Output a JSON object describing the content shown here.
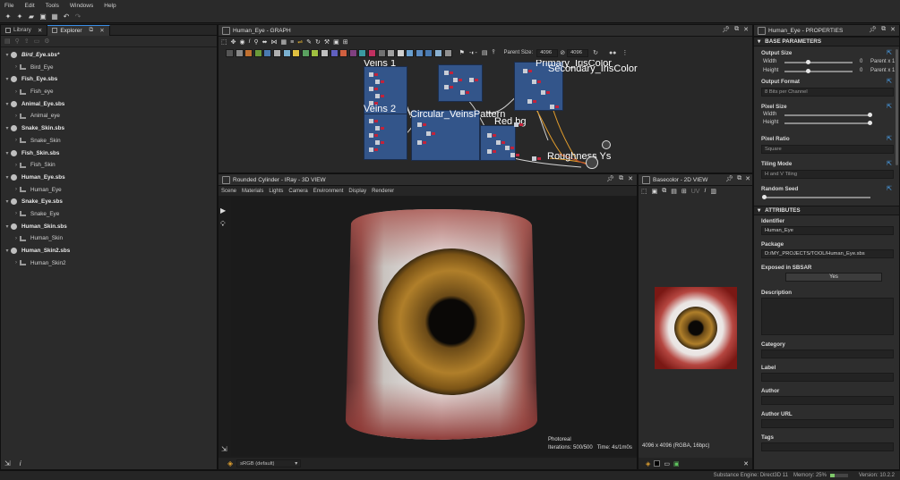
{
  "menu": [
    "File",
    "Edit",
    "Tools",
    "Windows",
    "Help"
  ],
  "left_panel": {
    "tabs": [
      "Library",
      "Explorer"
    ],
    "tree": [
      {
        "name": "Bird_Eye.sbs*",
        "child": "Bird_Eye",
        "italic": true
      },
      {
        "name": "Fish_Eye.sbs",
        "child": "Fish_eye"
      },
      {
        "name": "Animal_Eye.sbs",
        "child": "Animal_eye"
      },
      {
        "name": "Snake_Skin.sbs",
        "child": "Snake_Skin"
      },
      {
        "name": "Fish_Skin.sbs",
        "child": "Fish_Skin"
      },
      {
        "name": "Human_Eye.sbs",
        "child": "Human_Eye"
      },
      {
        "name": "Snake_Eye.sbs",
        "child": "Snake_Eye"
      },
      {
        "name": "Human_Skin.sbs",
        "child": "Human_Skin"
      },
      {
        "name": "Human_Skin2.sbs",
        "child": "Human_Skin2"
      }
    ]
  },
  "graph": {
    "title": "Human_Eye - GRAPH",
    "parent_size_label": "Parent Size:",
    "size_a": "4096",
    "size_b": "4096",
    "frames": {
      "veins1": "Veins 1",
      "veins2": "Veins 2",
      "circular": "Circular_VeinsPattern",
      "redbg": "Red bg",
      "primary": "Primary_IrisColor",
      "secondary": "Secondary_IrisColor",
      "roughness": "Roughness Ys"
    }
  },
  "view3d": {
    "title": "Rounded Cylinder - IRay - 3D VIEW",
    "menu": [
      "Scene",
      "Materials",
      "Lights",
      "Camera",
      "Environment",
      "Display",
      "Renderer"
    ],
    "render_mode": "Photoreal",
    "iterations": "Iterations: 500/500",
    "time": "Time: 4s/1m0s",
    "colorspace": "sRGB (default)"
  },
  "view2d": {
    "title": "Basecolor - 2D VIEW",
    "info": "4096 x 4096 (RGBA, 16bpc)"
  },
  "properties": {
    "title": "Human_Eye - PROPERTIES",
    "base_parameters": "BASE PARAMETERS",
    "output_size": "Output Size",
    "width": "Width",
    "height": "Height",
    "width_value": "0",
    "height_value": "0",
    "width_rel": "Parent x 1",
    "height_rel": "Parent x 1",
    "output_format": "Output Format",
    "output_format_value": "8 Bits per Channel",
    "pixel_size": "Pixel Size",
    "pixel_ratio": "Pixel Ratio",
    "pixel_ratio_value": "Square",
    "tiling_mode": "Tiling Mode",
    "tiling_mode_value": "H and V Tiling",
    "random_seed": "Random Seed",
    "attributes": "ATTRIBUTES",
    "identifier": "Identifier",
    "identifier_value": "Human_Eye",
    "package": "Package",
    "package_value": "D:/MY_PROJECTS/TOOL/Human_Eye.sbs",
    "exposed": "Exposed in SBSAR",
    "exposed_value": "Yes",
    "description": "Description",
    "category": "Category",
    "label": "Label",
    "author": "Author",
    "author_url": "Author URL",
    "tags": "Tags"
  },
  "status": {
    "engine": "Substance Engine: Direct3D 11",
    "memory": "Memory: 25%",
    "version": "Version: 10.2.2"
  }
}
